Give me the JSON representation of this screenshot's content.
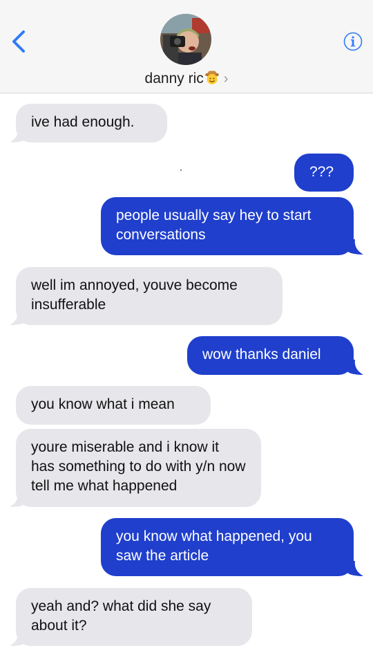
{
  "header": {
    "contact_name": "danny ric",
    "contact_emoji": "cowboy-face-emoji",
    "back_icon": "chevron-left-icon",
    "info_icon": "info-icon",
    "accent_color": "#1f6fe6"
  },
  "messages": [
    {
      "direction": "incoming",
      "text": "ive had enough."
    },
    {
      "direction": "outgoing",
      "text": "???"
    },
    {
      "direction": "outgoing",
      "text": "people usually say hey to start conversations"
    },
    {
      "direction": "incoming",
      "text": "well im annoyed, youve become insufferable"
    },
    {
      "direction": "outgoing",
      "text": "wow thanks daniel"
    },
    {
      "direction": "incoming",
      "text": "you know what i mean"
    },
    {
      "direction": "incoming",
      "text": "youre miserable and i know it has something to do with y/n now tell me what happened"
    },
    {
      "direction": "outgoing",
      "text": "you know what happened, you saw the article"
    },
    {
      "direction": "incoming",
      "text": "yeah and? what did she say about it?"
    }
  ],
  "colors": {
    "incoming_bubble": "#e6e6eb",
    "outgoing_bubble": "#1f3fcc",
    "header_bg": "#f6f6f7"
  }
}
